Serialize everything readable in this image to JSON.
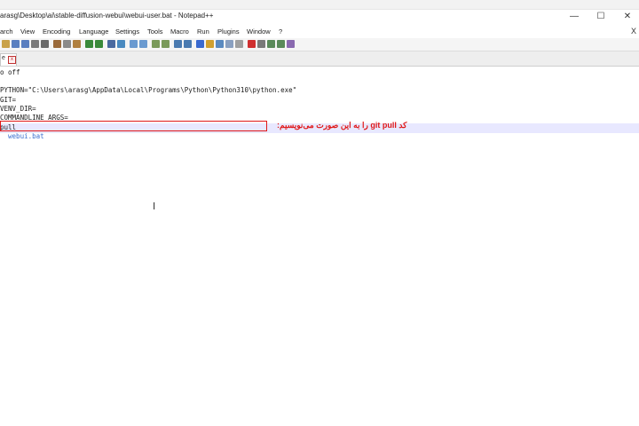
{
  "window": {
    "title": "arasg\\Desktop\\ai\\stable-diffusion-webui\\webui-user.bat - Notepad++",
    "minimize": "—",
    "maximize": "☐",
    "close": "✕"
  },
  "menu": {
    "items": [
      "arch",
      "View",
      "Encoding",
      "Language",
      "Settings",
      "Tools",
      "Macro",
      "Run",
      "Plugins",
      "Window",
      "?"
    ],
    "close": "X"
  },
  "tab": {
    "label": "e",
    "close": "x"
  },
  "editor": {
    "lines": [
      "o off",
      "",
      "PYTHON=\"C:\\Users\\arasg\\AppData\\Local\\Programs\\Python\\Python310\\python.exe\"",
      "GIT=",
      "VENV_DIR=",
      "COMMANDLINE_ARGS=",
      "pull",
      "  webui.bat"
    ]
  },
  "annotation": {
    "text": "کد git pull را به این صورت می‌نویسیم:"
  },
  "colors": {
    "highlight": "#e01818",
    "current_line": "#e8e8ff",
    "link_text": "#3a6fd0"
  }
}
